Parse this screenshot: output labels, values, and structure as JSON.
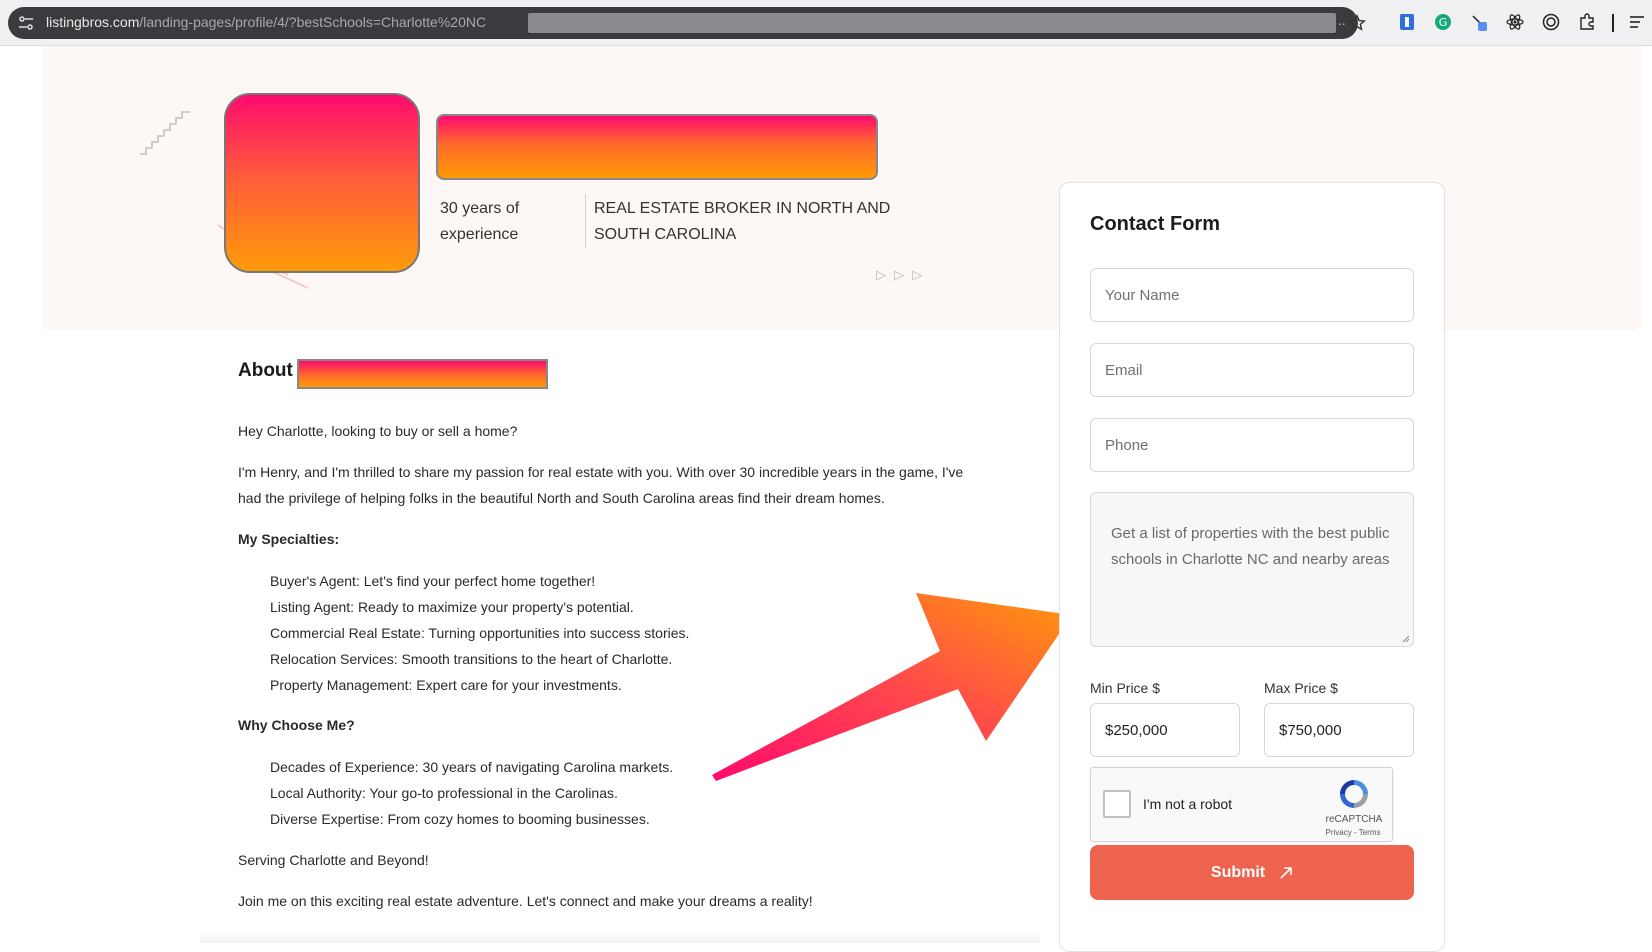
{
  "browser": {
    "url_host": "listingbros.com",
    "url_path": "/landing-pages/profile/4/?bestSchools=Charlotte%20NC",
    "url_trailing": "..",
    "extension_icons": [
      "extension-blue-icon",
      "grammarly-icon",
      "pen-icon",
      "react-icon",
      "record-icon",
      "puzzle-icon",
      "menu-icon"
    ]
  },
  "hero": {
    "experience": "30 years of experience",
    "role": "REAL ESTATE BROKER IN NORTH AND SOUTH CAROLINA",
    "decor_arrows": "▷ ▷ ▷"
  },
  "about": {
    "heading": "About C",
    "greeting": "Hey Charlotte, looking to buy or sell a home?",
    "intro_line1": "I'm Henry, and I'm thrilled to share my passion for real estate with you. With over 30 incredible years in the game, I've",
    "intro_line2": "had the privilege of helping folks in the beautiful North and South Carolina areas find their dream homes.",
    "specialties_heading": "My Specialties:",
    "specialties": [
      "Buyer's Agent: Let's find your perfect home together!",
      "Listing Agent: Ready to maximize your property's potential.",
      "Commercial Real Estate: Turning opportunities into success stories.",
      "Relocation Services: Smooth transitions to the heart of Charlotte.",
      "Property Management: Expert care for your investments."
    ],
    "why_heading": "Why Choose Me?",
    "why": [
      "Decades of Experience: 30 years of navigating Carolina markets.",
      "Local Authority: Your go-to professional in the Carolinas.",
      "Diverse Expertise: From cozy homes to booming businesses."
    ],
    "serving": "Serving Charlotte and Beyond!",
    "closing": "Join me on this exciting real estate adventure. Let's connect and make your dreams a reality!"
  },
  "form": {
    "title": "Contact Form",
    "name_placeholder": "Your Name",
    "email_placeholder": "Email",
    "phone_placeholder": "Phone",
    "message": "Get a list of properties with the best public schools in Charlotte NC and nearby areas",
    "min_label": "Min Price $",
    "min_value": "$250,000",
    "max_label": "Max Price $",
    "max_value": "$750,000",
    "captcha_label": "I'm not a robot",
    "captcha_brand": "reCAPTCHA",
    "captcha_links": "Privacy - Terms",
    "submit_label": "Submit"
  },
  "colors": {
    "accent_submit": "#ee6350",
    "gradient_top": "#ff0a6e",
    "gradient_bottom": "#ff9b0a",
    "hero_bg": "#fdf7f5"
  }
}
